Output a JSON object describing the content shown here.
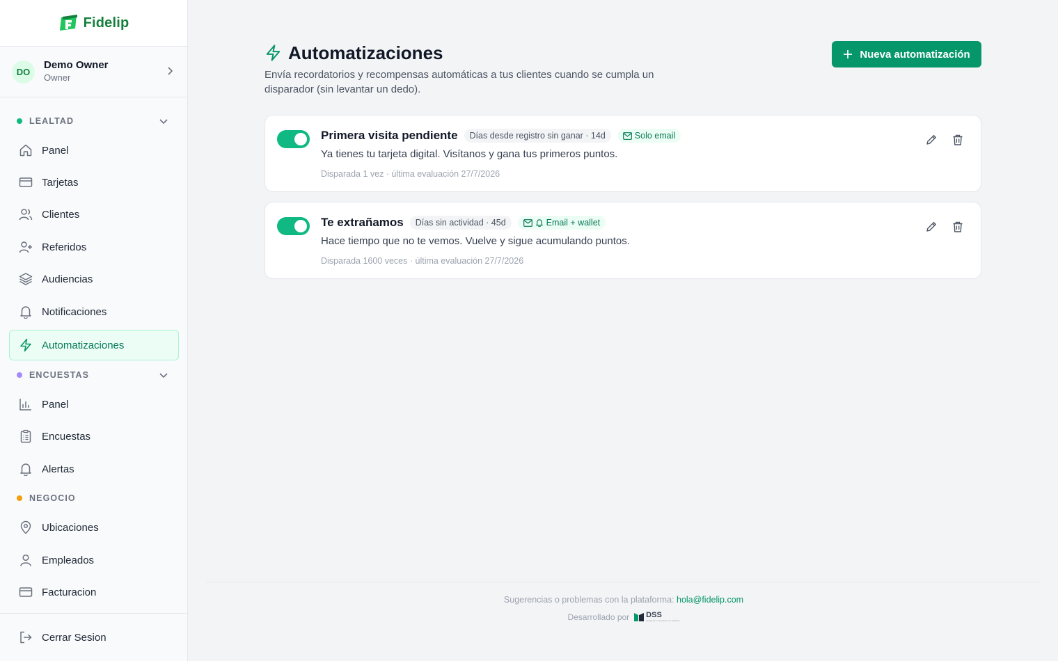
{
  "brand": {
    "name": "Fidelip",
    "primary_color": "#059669"
  },
  "user": {
    "initials": "DO",
    "name": "Demo Owner",
    "role": "Owner"
  },
  "sidebar": {
    "sections": [
      {
        "label": "LEALTAD",
        "dot_color": "#10b981"
      },
      {
        "label": "ENCUESTAS",
        "dot_color": "#a78bfa"
      },
      {
        "label": "NEGOCIO",
        "dot_color": "#f59e0b"
      }
    ],
    "lealtad_items": [
      "Panel",
      "Tarjetas",
      "Clientes",
      "Referidos",
      "Audiencias",
      "Notificaciones",
      "Automatizaciones"
    ],
    "encuestas_items": [
      "Panel",
      "Encuestas",
      "Alertas"
    ],
    "negocio_items": [
      "Ubicaciones",
      "Empleados",
      "Facturacion"
    ],
    "logout": "Cerrar Sesion",
    "active_item": "Automatizaciones"
  },
  "page": {
    "title": "Automatizaciones",
    "description": "Envía recordatorios y recompensas automáticas a tus clientes cuando se cumpla un disparador (sin levantar un dedo).",
    "new_button": "Nueva automatización"
  },
  "automations": [
    {
      "enabled": true,
      "title": "Primera visita pendiente",
      "trigger": "Días desde registro sin ganar · 14d",
      "channel": "Solo email",
      "message": "Ya tienes tu tarjeta digital. Visítanos y gana tus primeros puntos.",
      "meta": "Disparada 1 vez · última evaluación 27/7/2026"
    },
    {
      "enabled": true,
      "title": "Te extrañamos",
      "trigger": "Días sin actividad · 45d",
      "channel": "Email + wallet",
      "message": "Hace tiempo que no te vemos. Vuelve y sigue acumulando puntos.",
      "meta": "Disparada 1600 veces · última evaluación 27/7/2026"
    }
  ],
  "footer": {
    "feedback": "Sugerencias o problemas con la plataforma:",
    "email": "hola@fidelip.com",
    "developed_by": "Desarrollado por",
    "dev_logo": "DSS",
    "dev_tagline": "Desarrollo e Innovación de Software"
  }
}
